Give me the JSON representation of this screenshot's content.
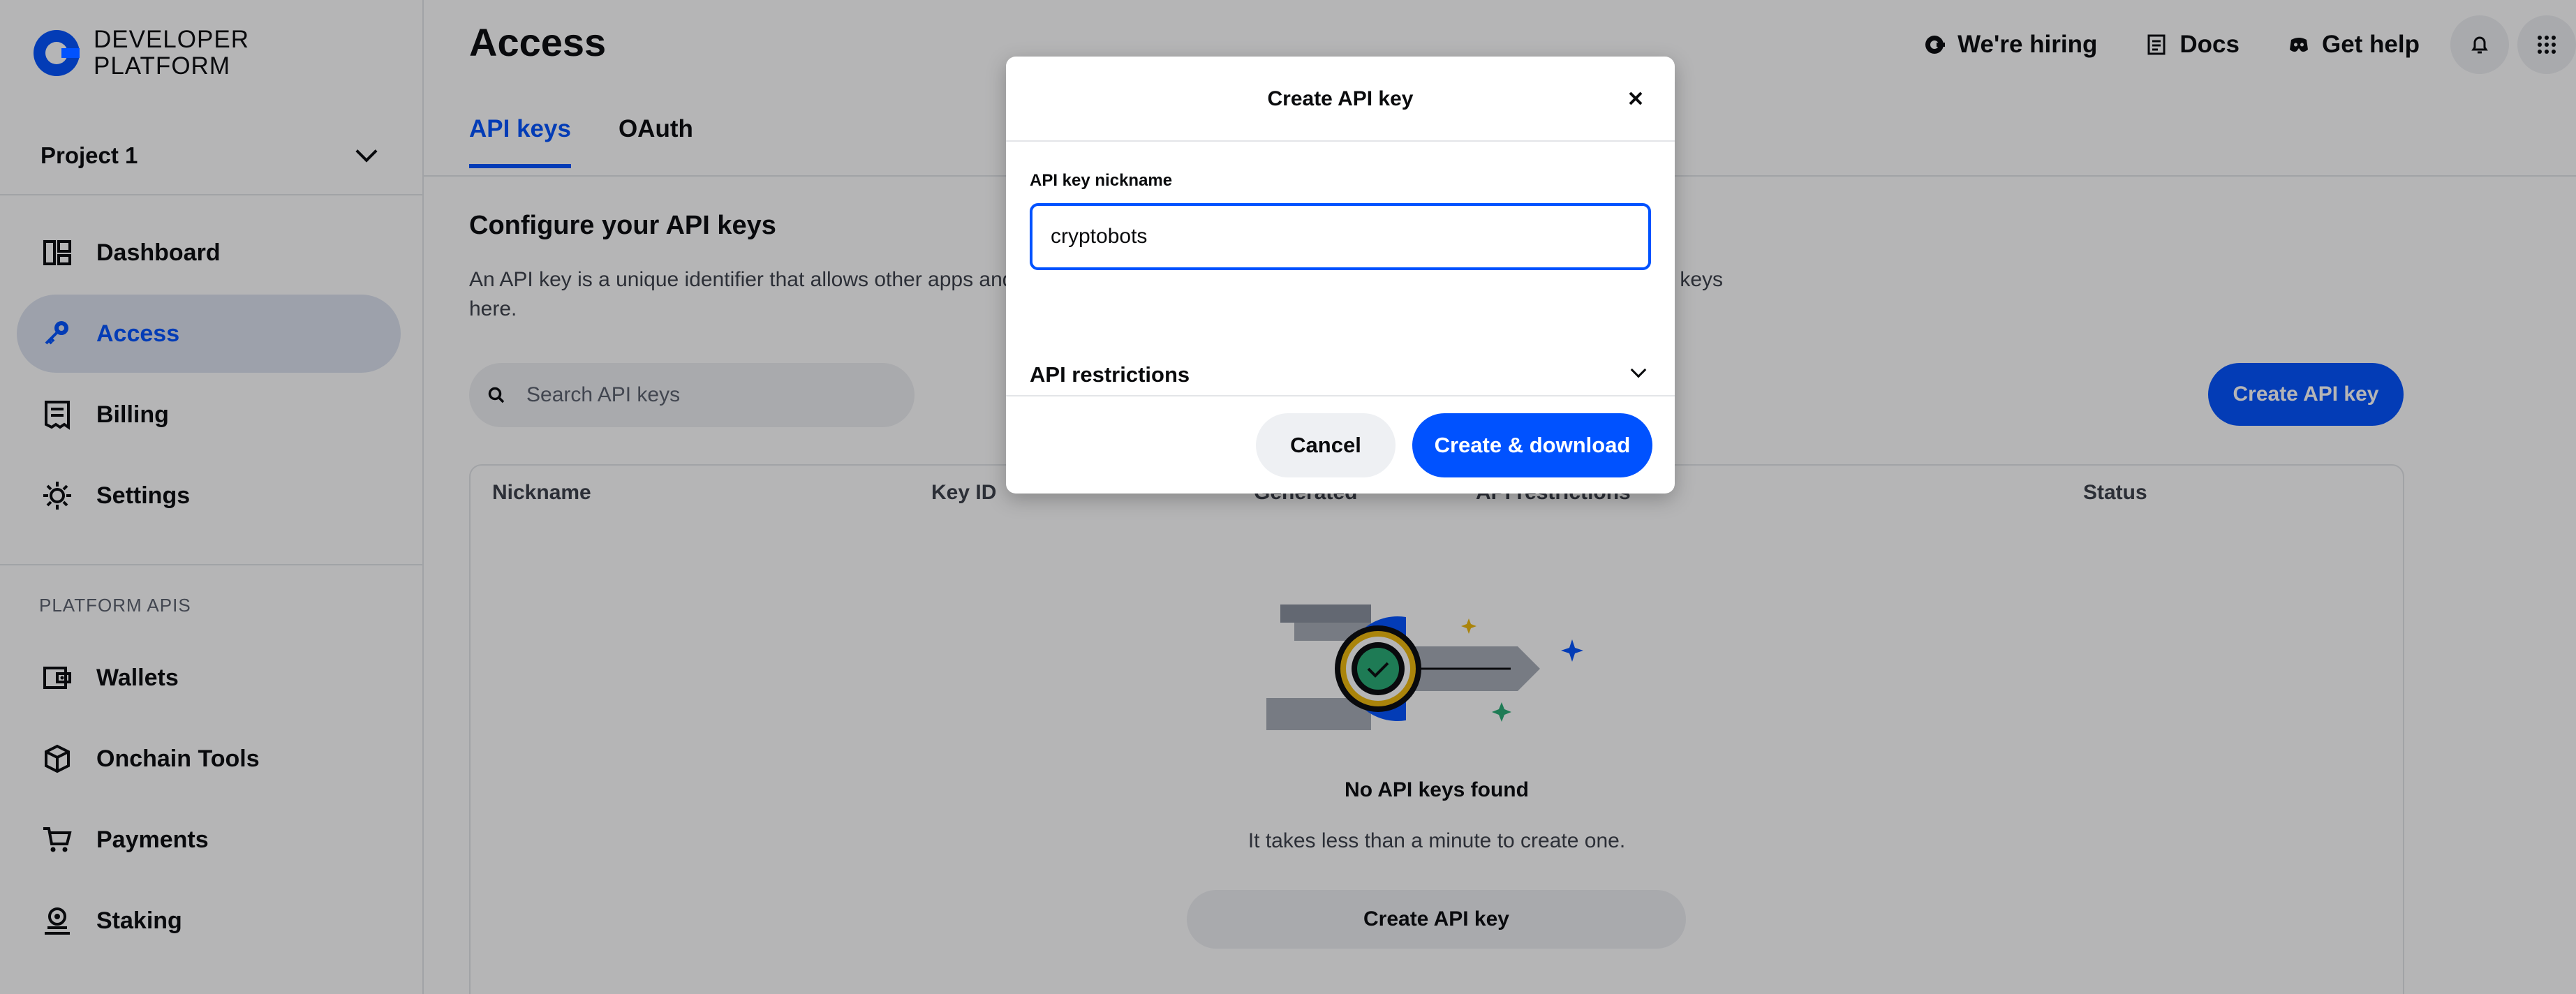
{
  "brand": {
    "line1": "DEVELOPER",
    "line2": "PLATFORM",
    "color": "#0052ff"
  },
  "project": {
    "label": "Project 1"
  },
  "sidebar": {
    "items": [
      {
        "label": "Dashboard",
        "icon": "dashboard-icon"
      },
      {
        "label": "Access",
        "icon": "key-icon",
        "active": true
      },
      {
        "label": "Billing",
        "icon": "receipt-icon"
      },
      {
        "label": "Settings",
        "icon": "gear-icon"
      }
    ],
    "section": "PLATFORM APIS",
    "api_items": [
      {
        "label": "Wallets",
        "icon": "wallet-icon"
      },
      {
        "label": "Onchain Tools",
        "icon": "cube-icon"
      },
      {
        "label": "Payments",
        "icon": "cart-icon"
      },
      {
        "label": "Staking",
        "icon": "staking-icon"
      }
    ]
  },
  "header": {
    "title": "Access",
    "links": [
      {
        "label": "We're hiring",
        "icon": "coinbase-icon"
      },
      {
        "label": "Docs",
        "icon": "document-icon"
      },
      {
        "label": "Get help",
        "icon": "discord-icon"
      }
    ]
  },
  "tabs": [
    {
      "label": "API keys",
      "active": true
    },
    {
      "label": "OAuth"
    }
  ],
  "main": {
    "heading": "Configure your API keys",
    "description": "An API key is a unique identifier that allows other apps and services to access your project. You can create and configure your API keys here.",
    "search_placeholder": "Search API keys",
    "create_button": "Create API key"
  },
  "table": {
    "columns": [
      "Nickname",
      "Key ID",
      "Generated",
      "API restrictions",
      "Status"
    ],
    "empty_title": "No API keys found",
    "empty_subtitle": "It takes less than a minute to create one.",
    "empty_button": "Create API key"
  },
  "modal": {
    "title": "Create API key",
    "field_label": "API key nickname",
    "field_value": "cryptobots",
    "restrictions_label": "API restrictions",
    "cancel": "Cancel",
    "confirm": "Create & download"
  }
}
